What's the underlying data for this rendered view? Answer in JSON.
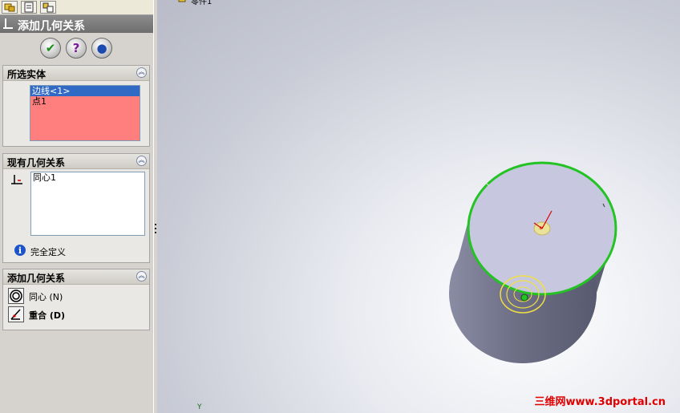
{
  "panel": {
    "title": "添加几何关系",
    "buttons": {
      "ok_icon": "check-icon",
      "help_icon": "help-icon",
      "detail_icon": "detail-preview-icon"
    },
    "selected_entities": {
      "header": "所选实体",
      "items": [
        "边线<1>",
        "点1"
      ]
    },
    "existing_relations": {
      "header": "现有几何关系",
      "items": [
        "同心1"
      ],
      "status": "完全定义"
    },
    "add_relations": {
      "header": "添加几何关系",
      "options": [
        {
          "label": "同心 (N)",
          "icon": "concentric-icon"
        },
        {
          "label": "重合 (D)",
          "icon": "coincident-icon"
        }
      ]
    }
  },
  "viewport": {
    "top_label": "零件1",
    "axis_label": "Y",
    "watermark": "三维网www.3dportal.cn"
  },
  "colors": {
    "selection_blue": "#316ac5",
    "selection_pink": "#ff7f7f",
    "edge_green": "#22c322",
    "highlight_yellow": "#f0e040",
    "watermark_red": "#e00000"
  }
}
